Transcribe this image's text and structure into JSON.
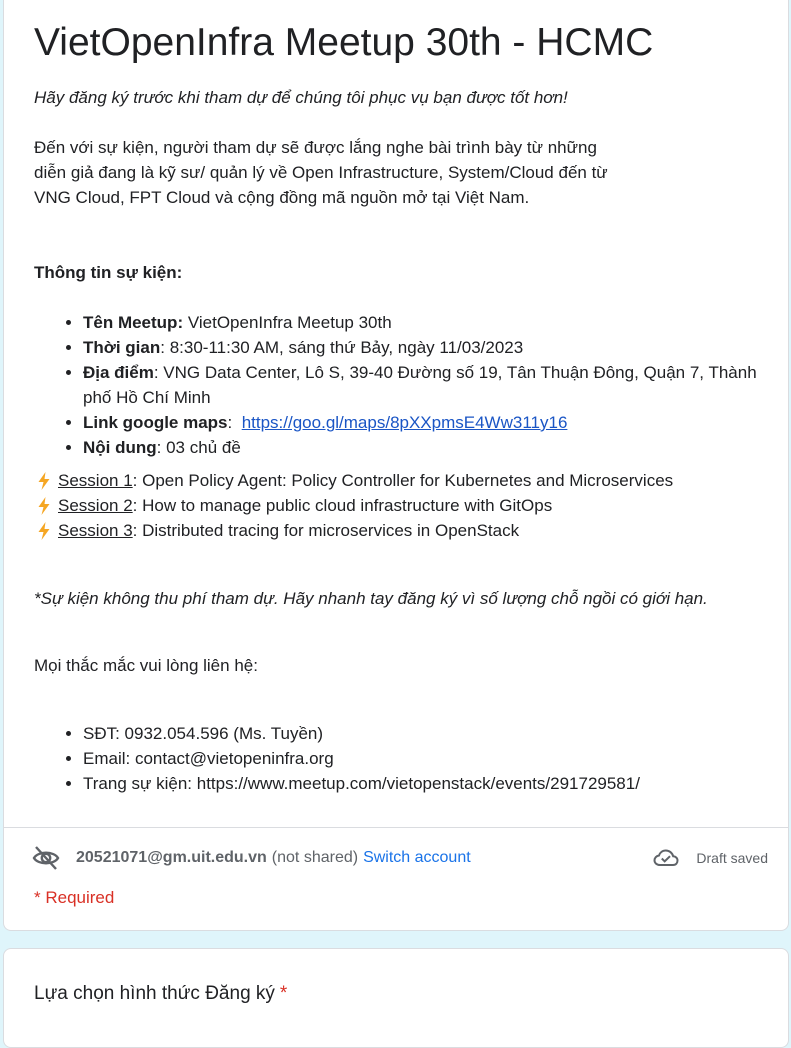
{
  "form": {
    "title": "VietOpenInfra Meetup 30th - HCMC",
    "intro_italic": "Hãy đăng ký trước khi tham dự để chúng tôi phục vụ bạn được tốt hơn!",
    "intro_lines": [
      "Đến với sự kiện, người tham dự sẽ được lắng nghe bài trình bày từ những",
      "diễn giả đang là kỹ sư/ quản lý về Open Infrastructure, System/Cloud đến từ",
      "VNG Cloud, FPT Cloud và cộng đồng mã nguồn mở tại Việt Nam."
    ],
    "info_heading": "Thông tin sự kiện:",
    "info_items": [
      {
        "label": "Tên Meetup:",
        "value": " VietOpenInfra Meetup 30th"
      },
      {
        "label": "Thời gian",
        "value": ": 8:30-11:30 AM, sáng thứ Bảy, ngày 11/03/2023"
      },
      {
        "label": "Địa điểm",
        "value": ": VNG Data Center, Lô S, 39-40 Đường số 19, Tân Thuận Đông, Quận 7, Thành phố Hồ Chí Minh"
      },
      {
        "label": "Link google maps",
        "value": ":  ",
        "link": "https://goo.gl/maps/8pXXpmsE4Ww311y16"
      },
      {
        "label": "Nội dung",
        "value": ": 03 chủ đề"
      }
    ],
    "sessions": [
      {
        "label": "Session 1",
        "text": ": Open Policy Agent: Policy Controller for Kubernetes and Microservices"
      },
      {
        "label": "Session 2",
        "text": ": How to manage public cloud infrastructure with GitOps"
      },
      {
        "label": "Session 3",
        "text": ": Distributed tracing for microservices in OpenStack"
      }
    ],
    "free_note": "*Sự kiện không thu phí tham dự. Hãy nhanh tay đăng ký vì số lượng chỗ ngồi có giới hạn.",
    "contact_heading": "Mọi thắc mắc vui lòng liên hệ:",
    "contacts": [
      "SĐT: 0932.054.596 (Ms. Tuyền)",
      "Email: contact@vietopeninfra.org",
      "Trang sự kiện: https://www.meetup.com/vietopenstack/events/291729581/"
    ]
  },
  "account": {
    "email": "20521071@gm.uit.edu.vn",
    "not_shared": "(not shared)",
    "switch_label": "Switch account",
    "draft_status": "Draft saved",
    "icons": {
      "hidden": "eye-off-icon",
      "cloud": "cloud-done-icon"
    }
  },
  "required_note": "* Required",
  "question": {
    "title": "Lựa chọn hình thức Đăng ký",
    "required_mark": "*"
  },
  "colors": {
    "background": "#dff5fb",
    "link": "#1a55c5",
    "switch_link": "#1a73e8",
    "required": "#d93025",
    "bolt": "#f5a623"
  }
}
